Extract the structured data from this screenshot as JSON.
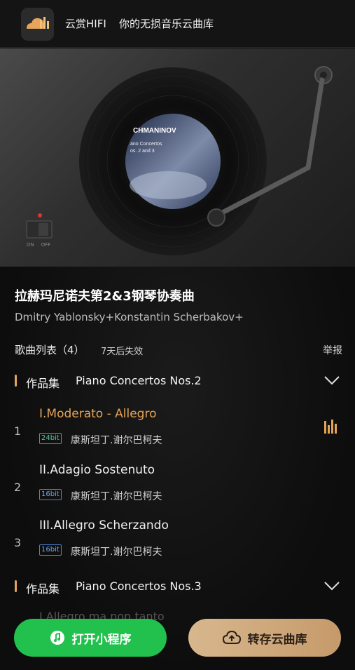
{
  "header": {
    "app_name": "云赏HIFI",
    "slogan": "你的无损音乐云曲库"
  },
  "album": {
    "cover_lines": [
      "CHMANINOV",
      "ano Concertos",
      "os. 2 and 3"
    ],
    "title": "拉赫玛尼诺夫第2&3钢琴协奏曲",
    "artists": "Dmitry Yablonsky+Konstantin Scherbakov+"
  },
  "switch": {
    "on": "ON",
    "off": "OFF"
  },
  "list": {
    "header": "歌曲列表（4）",
    "expire": "7天后失效",
    "report": "举报"
  },
  "sections": [
    {
      "label": "作品集",
      "name": "Piano Concertos Nos.2",
      "tracks": [
        {
          "num": "1",
          "title": "I.Moderato - Allegro",
          "bit": "24bit",
          "artist": "康斯坦丁.谢尔巴柯夫",
          "playing": true
        },
        {
          "num": "2",
          "title": "II.Adagio Sostenuto",
          "bit": "16bit",
          "artist": "康斯坦丁.谢尔巴柯夫",
          "playing": false
        },
        {
          "num": "3",
          "title": "III.Allegro Scherzando",
          "bit": "16bit",
          "artist": "康斯坦丁.谢尔巴柯夫",
          "playing": false
        }
      ]
    },
    {
      "label": "作品集",
      "name": "Piano Concertos Nos.3",
      "tracks": []
    }
  ],
  "faded_track": "I.Allegro ma non tanto",
  "buttons": {
    "open_miniprogram": "打开小程序",
    "save_cloud": "转存云曲库"
  },
  "colors": {
    "accent": "#e5a355",
    "green": "#22c14e",
    "gold": "#d8b78e"
  },
  "icons": [
    "app-logo-icon",
    "chevron-down-icon",
    "equalizer-icon",
    "music-note-icon",
    "cloud-upload-icon"
  ]
}
